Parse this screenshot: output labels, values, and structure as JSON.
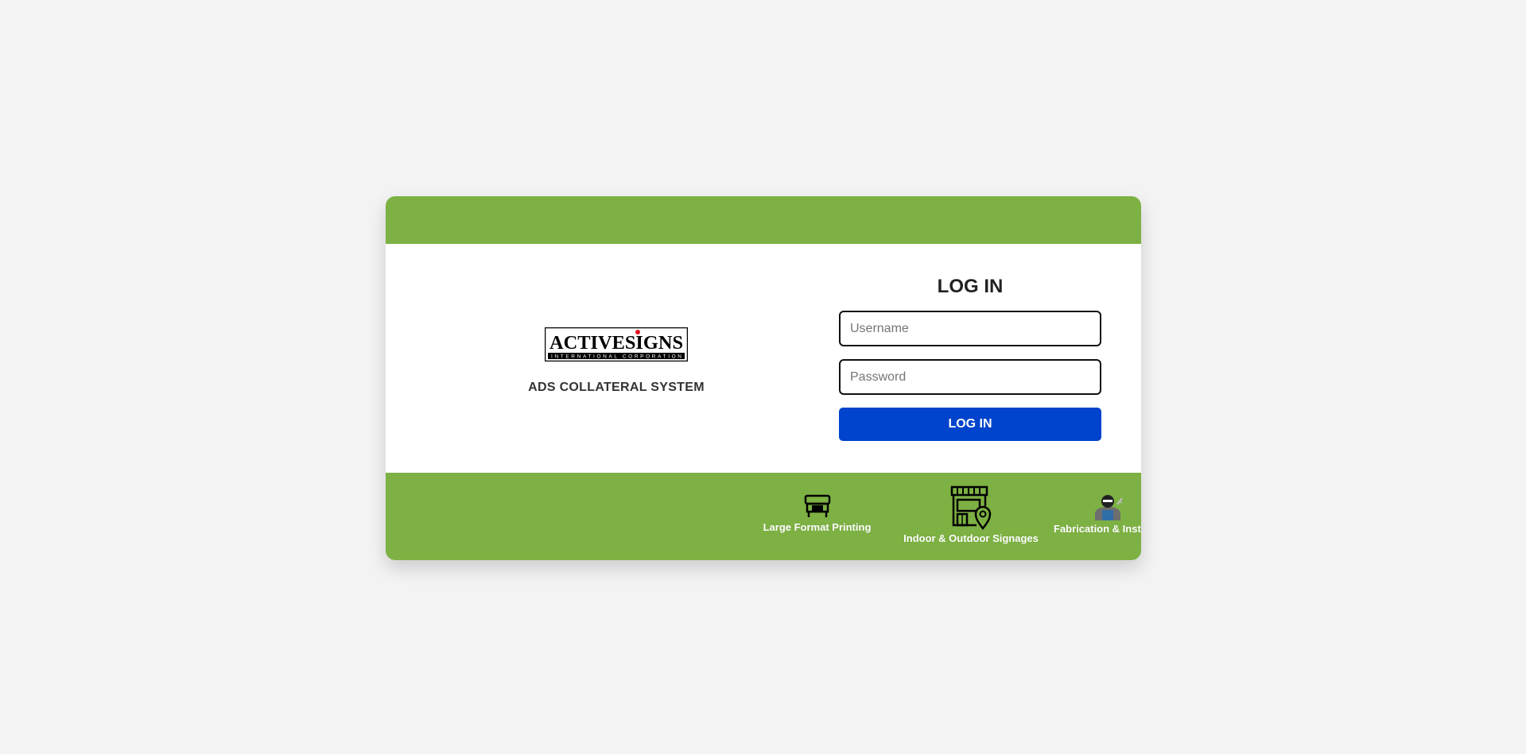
{
  "brand": {
    "logo_text": "ACTIVESIGNS",
    "logo_subtext": "INTERNATIONAL CORPORATION",
    "system_title": "ADS COLLATERAL SYSTEM"
  },
  "login": {
    "title": "LOG IN",
    "username_placeholder": "Username",
    "password_placeholder": "Password",
    "submit_label": "LOG IN"
  },
  "services": [
    {
      "icon": "printer-icon",
      "label": "Large Format Printing"
    },
    {
      "icon": "storefront-location-icon",
      "label": "Indoor & Outdoor Signages"
    },
    {
      "icon": "welder-icon",
      "label": "Fabrication & Install"
    }
  ],
  "colors": {
    "accent_green": "#7db143",
    "button_blue": "#0043cc",
    "background": "#f3f3f3"
  }
}
